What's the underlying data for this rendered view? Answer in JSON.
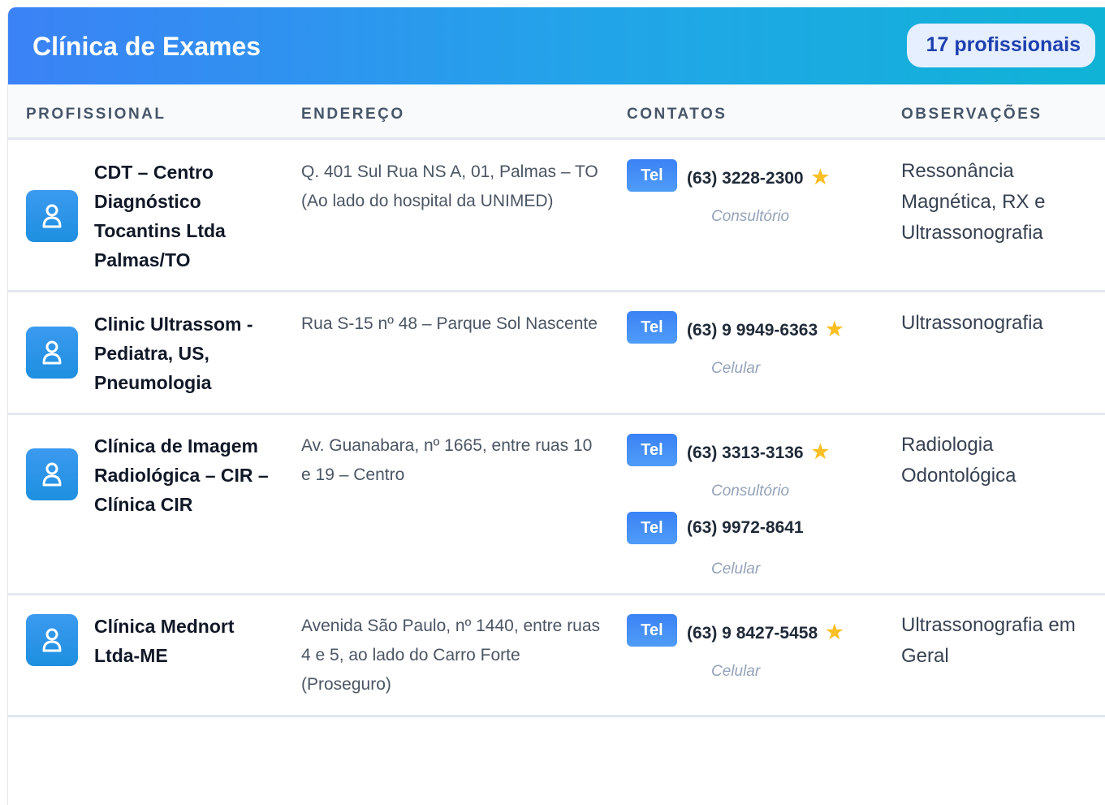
{
  "header": {
    "title": "Clínica de Exames",
    "count_label": "17 profissionais"
  },
  "columns": {
    "professional": "PROFISSIONAL",
    "address": "ENDEREÇO",
    "contacts": "CONTATOS",
    "notes": "OBSERVAÇÕES"
  },
  "rows": [
    {
      "name": "CDT – Centro Diagnóstico Tocantins Ltda Palmas/TO",
      "address": "Q. 401 Sul Rua NS A, 01, Palmas – TO (Ao lado do hospital da UNIMED)",
      "contacts": [
        {
          "badge": "Tel",
          "phone": "(63) 3228-2300",
          "star": "★",
          "type": "Consultório"
        }
      ],
      "notes": "Ressonância Magnética, RX e Ultrassonografia"
    },
    {
      "name": "Clinic Ultrassom - Pediatra, US, Pneumologia",
      "address": "Rua S-15 nº 48 – Parque Sol Nascente",
      "contacts": [
        {
          "badge": "Tel",
          "phone": "(63) 9 9949-6363",
          "star": "★",
          "type": "Celular"
        }
      ],
      "notes": "Ultrassonografia"
    },
    {
      "name": "Clínica de Imagem Radiológica – CIR – Clínica CIR",
      "address": "Av. Guanabara, nº 1665, entre ruas 10 e 19 – Centro",
      "contacts": [
        {
          "badge": "Tel",
          "phone": "(63) 3313-3136",
          "star": "★",
          "type": "Consultório"
        },
        {
          "badge": "Tel",
          "phone": "(63) 9972-8641",
          "star": "",
          "type": "Celular"
        }
      ],
      "notes": "Radiologia Odontológica"
    },
    {
      "name": "Clínica Mednort Ltda-ME",
      "address": "Avenida São Paulo, nº 1440, entre ruas 4 e 5, ao lado do Carro Forte (Proseguro)",
      "contacts": [
        {
          "badge": "Tel",
          "phone": "(63) 9 8427-5458",
          "star": "★",
          "type": "Celular"
        }
      ],
      "notes": "Ultrassonografia em Geral"
    }
  ],
  "colors": {
    "header_gradient_start": "#3b82f6",
    "header_gradient_end": "#0fb3d6",
    "badge_bg": "#e6efff",
    "badge_text": "#1e40af",
    "tel_badge": "#3b82f6",
    "star": "#fbbf24"
  },
  "icons": {
    "avatar": "user-icon",
    "favorite": "star-icon"
  }
}
